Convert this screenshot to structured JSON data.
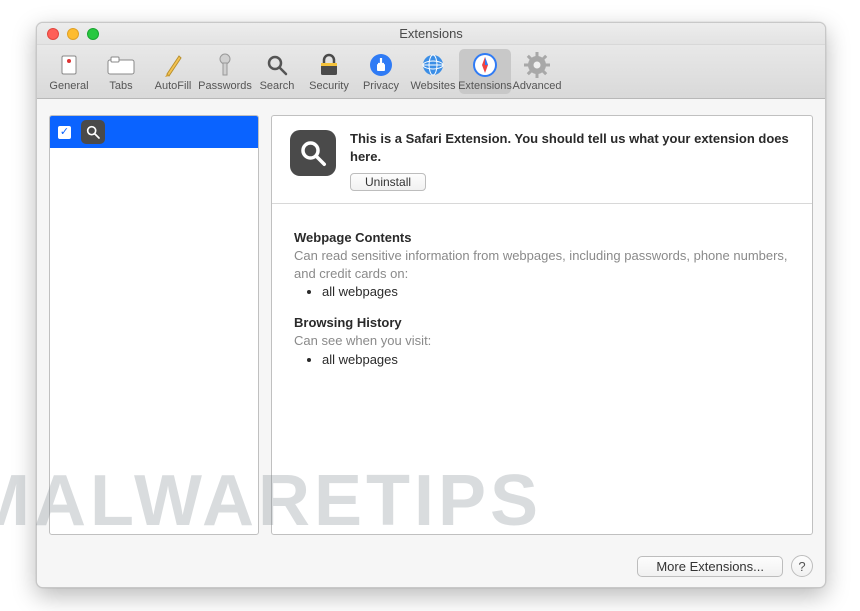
{
  "window": {
    "title": "Extensions"
  },
  "toolbar": {
    "items": [
      {
        "label": "General"
      },
      {
        "label": "Tabs"
      },
      {
        "label": "AutoFill"
      },
      {
        "label": "Passwords"
      },
      {
        "label": "Search"
      },
      {
        "label": "Security"
      },
      {
        "label": "Privacy"
      },
      {
        "label": "Websites"
      },
      {
        "label": "Extensions"
      },
      {
        "label": "Advanced"
      }
    ]
  },
  "sidebar": {
    "items": [
      {
        "checked": true,
        "icon": "search"
      }
    ]
  },
  "detail": {
    "description": "This is a Safari Extension. You should tell us what your extension does here.",
    "uninstall_label": "Uninstall",
    "permissions": [
      {
        "title": "Webpage Contents",
        "desc": "Can read sensitive information from webpages, including passwords, phone numbers, and credit cards on:",
        "items": [
          "all webpages"
        ]
      },
      {
        "title": "Browsing History",
        "desc": "Can see when you visit:",
        "items": [
          "all webpages"
        ]
      }
    ]
  },
  "footer": {
    "more_label": "More Extensions...",
    "help_label": "?"
  },
  "watermark": "MALWARETIPS"
}
